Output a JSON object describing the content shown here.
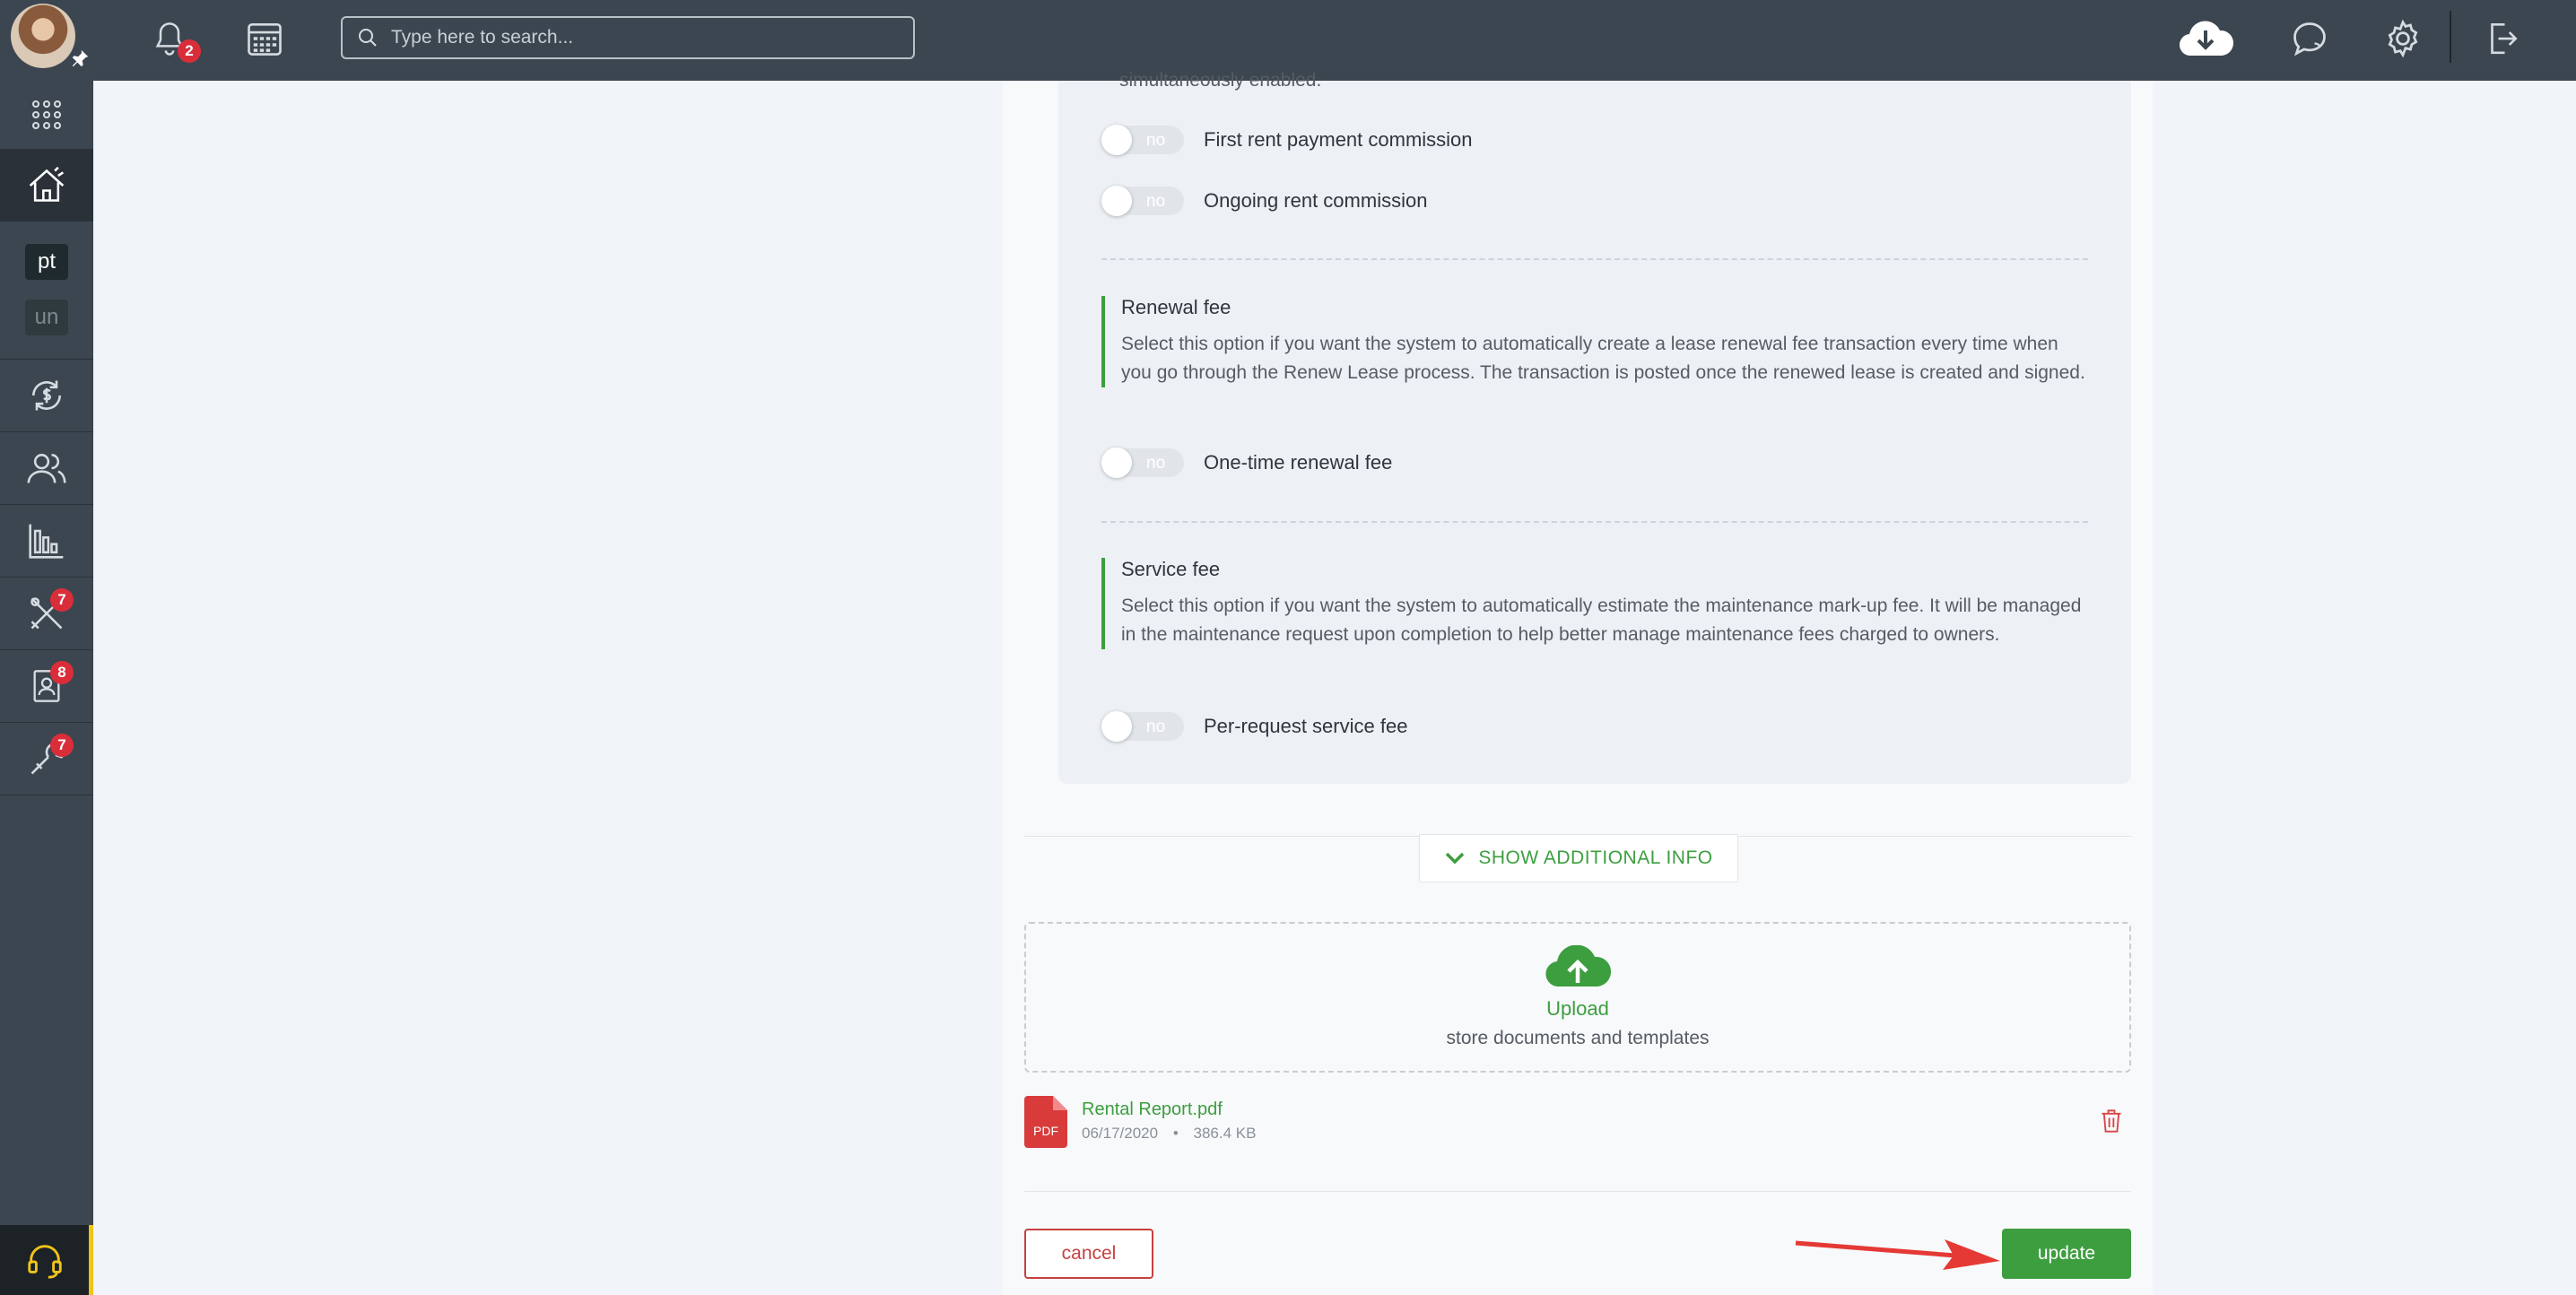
{
  "topbar": {
    "notifications_count": "2",
    "search_placeholder": "Type here to search..."
  },
  "sidebar": {
    "abbr_1": "pt",
    "abbr_2": "un",
    "maintenance_badge": "7",
    "contacts_badge": "8",
    "tools_badge": "7"
  },
  "content": {
    "wrapped_text": "simultaneously enabled.",
    "toggles": {
      "off_text": "no",
      "first_rent_label": "First rent payment commission",
      "ongoing_rent_label": "Ongoing rent commission",
      "renewal_label": "One-time renewal fee",
      "service_label": "Per-request service fee"
    },
    "renewal": {
      "title": "Renewal fee",
      "description": "Select this option if you want the system to automatically create a lease renewal fee transaction every time when you go through the Renew Lease process. The transaction is posted once the renewed lease is created and signed."
    },
    "service": {
      "title": "Service fee",
      "description": "Select this option if you want the system to automatically estimate the maintenance mark-up fee. It will be managed in the maintenance request upon completion to help better manage maintenance fees charged to owners."
    },
    "show_more_label": "SHOW ADDITIONAL INFO",
    "upload": {
      "title": "Upload",
      "subtitle": "store documents and templates"
    },
    "file": {
      "type": "PDF",
      "name": "Rental Report.pdf",
      "date": "06/17/2020",
      "separator": "•",
      "size": "386.4 KB"
    }
  },
  "actions": {
    "cancel_label": "cancel",
    "update_label": "update"
  },
  "colors": {
    "topbar": "#3c4650",
    "accent_green": "#3d9e3f",
    "danger_red": "#c94040",
    "badge_red": "#d92e3a"
  }
}
